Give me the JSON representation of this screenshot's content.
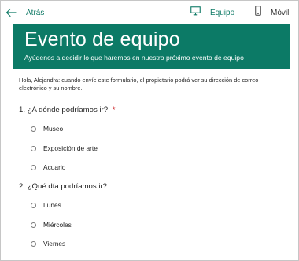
{
  "topbar": {
    "back_label": "Atrás",
    "views": [
      {
        "label": "Equipo",
        "icon": "monitor-icon",
        "active": true
      },
      {
        "label": "Móvil",
        "icon": "phone-icon",
        "active": false
      }
    ]
  },
  "form": {
    "title": "Evento de equipo",
    "subtitle": "Ayúdenos a decidir lo que haremos en nuestro próximo evento de equipo",
    "notice": "Hola, Alejandra: cuando envíe este formulario, el propietario podrá ver su dirección de correo electrónico y su nombre.",
    "questions": [
      {
        "number": "1.",
        "text": "¿A dónde podríamos ir?",
        "required_mark": "*",
        "options": [
          "Museo",
          "Exposición de arte",
          "Acuario"
        ]
      },
      {
        "number": "2.",
        "text": "¿Qué día podríamos ir?",
        "options": [
          "Lunes",
          "Miércoles",
          "Viernes"
        ]
      }
    ]
  },
  "colors": {
    "accent": "#0c7a66",
    "required": "#d13438"
  }
}
